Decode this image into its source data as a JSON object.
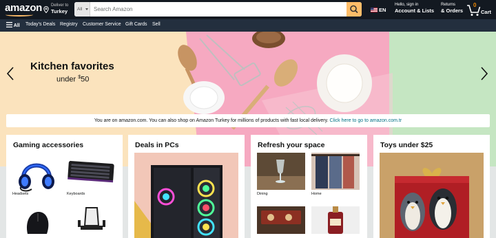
{
  "header": {
    "logo": "amazon",
    "deliver_line1": "Deliver to",
    "deliver_line2": "Turkey",
    "search_category": "All",
    "search_placeholder": "Search Amazon",
    "language": "EN",
    "account_line1": "Hello, sign in",
    "account_line2": "Account & Lists",
    "returns_line1": "Returns",
    "returns_line2": "& Orders",
    "cart_count": "0",
    "cart_label": "Cart"
  },
  "nav": {
    "all": "All",
    "items": [
      "Today's Deals",
      "Registry",
      "Customer Service",
      "Gift Cards",
      "Sell"
    ]
  },
  "hero": {
    "title": "Kitchen favorites",
    "subtitle_prefix": "under ",
    "currency": "$",
    "price": "50"
  },
  "notice": {
    "text": "You are on amazon.com. You can also shop on Amazon Turkey for millions of products with fast local delivery.",
    "link": "Click here to go to amazon.com.tr"
  },
  "cards": [
    {
      "title": "Gaming accessories",
      "items": [
        "Headsets",
        "Keyboards",
        "",
        ""
      ]
    },
    {
      "title": "Deals in PCs"
    },
    {
      "title": "Refresh your space",
      "items": [
        "Dining",
        "Home",
        "",
        ""
      ]
    },
    {
      "title": "Toys under $25"
    }
  ],
  "colors": {
    "header_bg": "#131921",
    "nav_bg": "#232f3e",
    "search_button": "#febd69",
    "link": "#007185",
    "cart_count": "#f08804"
  }
}
